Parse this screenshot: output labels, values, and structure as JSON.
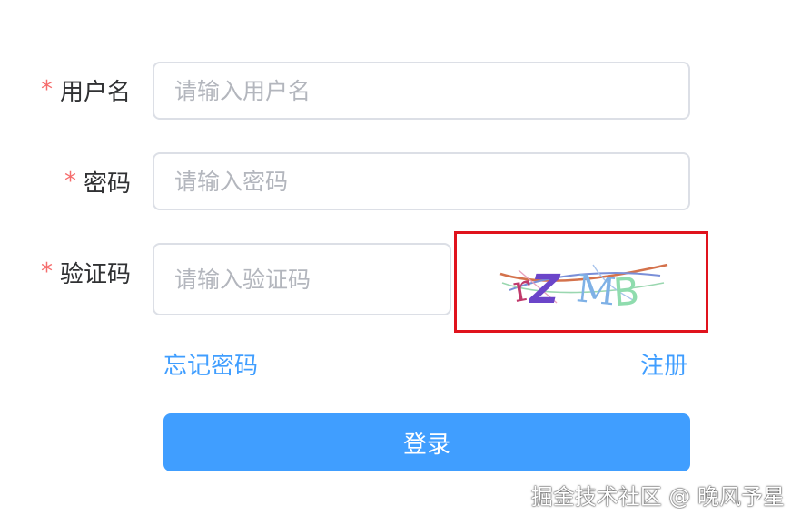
{
  "form": {
    "required_mark": "*",
    "username": {
      "label": "用户名",
      "placeholder": "请输入用户名",
      "value": ""
    },
    "password": {
      "label": "密码",
      "placeholder": "请输入密码",
      "value": ""
    },
    "captcha": {
      "label": "验证码",
      "placeholder": "请输入验证码",
      "value": "",
      "image_text": "rZMB"
    },
    "forgot_password_link": "忘记密码",
    "register_link": "注册",
    "login_button": "登录"
  },
  "watermark": "掘金技术社区 @ 晚风予星",
  "colors": {
    "accent": "#409eff",
    "required": "#f56c6c",
    "highlight_border": "#e0131d"
  }
}
